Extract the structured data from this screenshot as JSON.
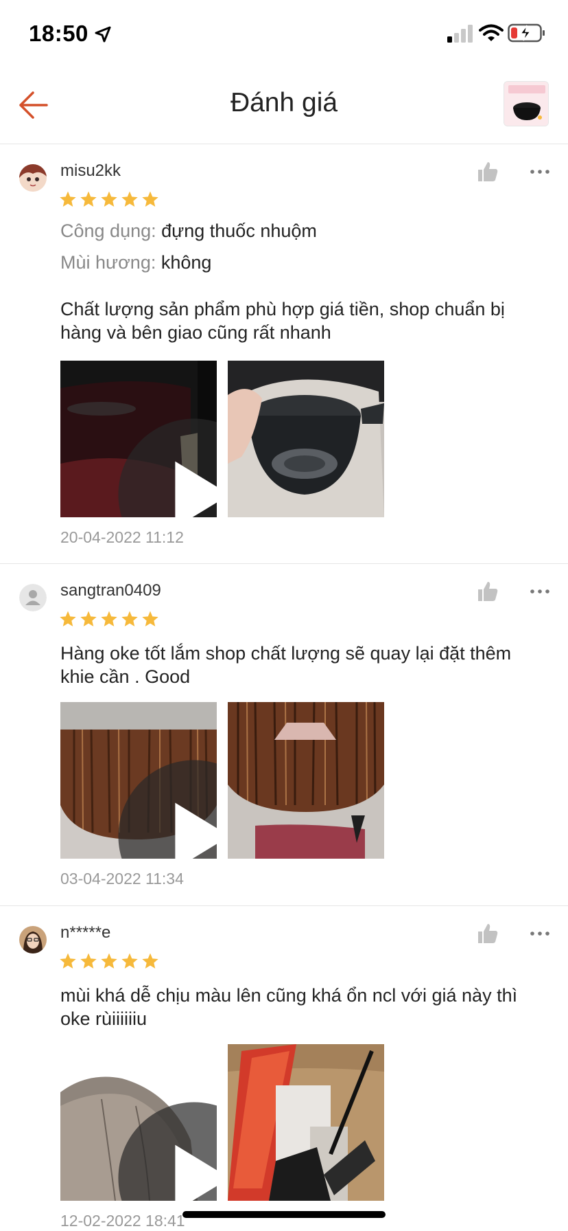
{
  "status_bar": {
    "time": "18:50"
  },
  "header": {
    "title": "Đánh giá",
    "back_icon": "arrow-left-icon",
    "accent_color": "#d4502a"
  },
  "star_color": "#f6b93b",
  "reviews": [
    {
      "username": "misu2kk",
      "rating": 5,
      "attributes": [
        {
          "label": "Công dụng:",
          "value": "đựng thuốc nhuộm"
        },
        {
          "label": "Mùi hương:",
          "value": "không"
        }
      ],
      "text": "Chất lượng sản phẩm phù hợp giá tiền, shop chuẩn bị hàng và bên giao cũng rất nhanh",
      "media": [
        {
          "type": "video"
        },
        {
          "type": "photo"
        }
      ],
      "date": "20-04-2022 11:12"
    },
    {
      "username": "sangtran0409",
      "rating": 5,
      "text": "Hàng oke tốt lắm shop chất lượng sẽ quay lại đặt thêm khie cần . Good",
      "media": [
        {
          "type": "video"
        },
        {
          "type": "photo"
        }
      ],
      "date": "03-04-2022 11:34"
    },
    {
      "username": "n*****e",
      "rating": 5,
      "text": "mùi khá dễ chịu màu lên cũng khá ổn ncl với giá này thì oke rùiiiiiiu",
      "media": [
        {
          "type": "video"
        },
        {
          "type": "photo"
        }
      ],
      "date": "12-02-2022 18:41"
    }
  ]
}
